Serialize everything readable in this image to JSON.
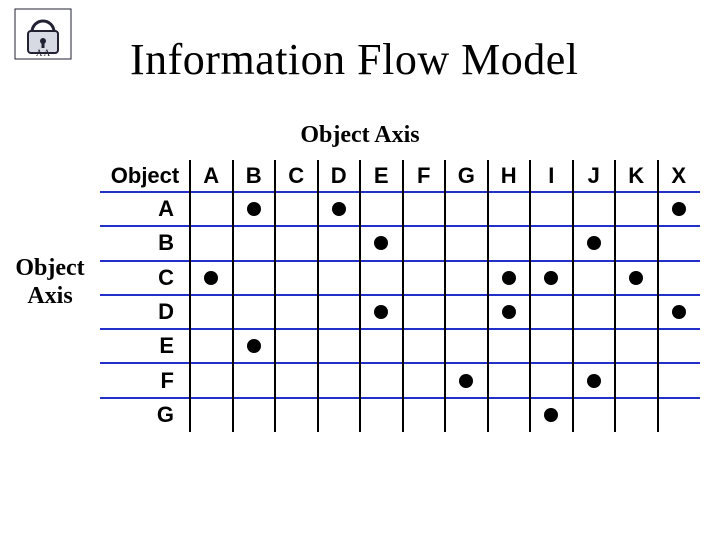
{
  "title": "Information Flow Model",
  "top_axis_label": "Object Axis",
  "left_axis_label_line1": "Object",
  "left_axis_label_line2": "Axis",
  "corner_label": "Object",
  "columns": [
    "A",
    "B",
    "C",
    "D",
    "E",
    "F",
    "G",
    "H",
    "I",
    "J",
    "K",
    "X"
  ],
  "rows": [
    "A",
    "B",
    "C",
    "D",
    "E",
    "F",
    "G"
  ],
  "chart_data": {
    "type": "heatmap",
    "title": "Information Flow Model — Object Axis matrix",
    "xlabel": "Object Axis",
    "ylabel": "Object Axis",
    "x_categories": [
      "A",
      "B",
      "C",
      "D",
      "E",
      "F",
      "G",
      "H",
      "I",
      "J",
      "K",
      "X"
    ],
    "y_categories": [
      "A",
      "B",
      "C",
      "D",
      "E",
      "F",
      "G"
    ],
    "points": [
      {
        "row": "A",
        "col": "B"
      },
      {
        "row": "A",
        "col": "D"
      },
      {
        "row": "A",
        "col": "X"
      },
      {
        "row": "B",
        "col": "E"
      },
      {
        "row": "B",
        "col": "J"
      },
      {
        "row": "C",
        "col": "A"
      },
      {
        "row": "C",
        "col": "H"
      },
      {
        "row": "C",
        "col": "I"
      },
      {
        "row": "C",
        "col": "K"
      },
      {
        "row": "D",
        "col": "E"
      },
      {
        "row": "D",
        "col": "H"
      },
      {
        "row": "D",
        "col": "X"
      },
      {
        "row": "E",
        "col": "B"
      },
      {
        "row": "F",
        "col": "G"
      },
      {
        "row": "F",
        "col": "J"
      },
      {
        "row": "G",
        "col": "I"
      }
    ]
  }
}
